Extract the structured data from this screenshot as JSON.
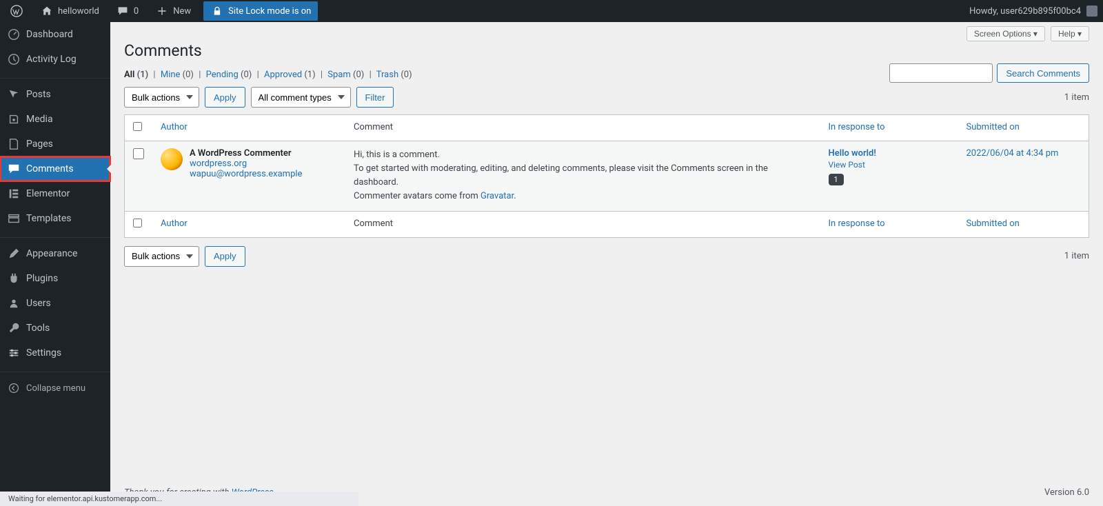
{
  "adminbar": {
    "site_name": "helloworld",
    "comment_count": "0",
    "new_label": "New",
    "site_lock_label": "Site Lock mode is on",
    "howdy_prefix": "Howdy, ",
    "user_name": "user629b895f00bc4"
  },
  "sidebar": {
    "items": [
      {
        "label": "Dashboard",
        "icon": "dashboard-icon"
      },
      {
        "label": "Activity Log",
        "icon": "activity-log-icon"
      },
      {
        "label": "Posts",
        "icon": "posts-icon"
      },
      {
        "label": "Media",
        "icon": "media-icon"
      },
      {
        "label": "Pages",
        "icon": "pages-icon"
      },
      {
        "label": "Comments",
        "icon": "comments-icon",
        "current": true
      },
      {
        "label": "Elementor",
        "icon": "elementor-icon"
      },
      {
        "label": "Templates",
        "icon": "templates-icon"
      },
      {
        "label": "Appearance",
        "icon": "appearance-icon"
      },
      {
        "label": "Plugins",
        "icon": "plugins-icon"
      },
      {
        "label": "Users",
        "icon": "users-icon"
      },
      {
        "label": "Tools",
        "icon": "tools-icon"
      },
      {
        "label": "Settings",
        "icon": "settings-icon"
      }
    ],
    "collapse_label": "Collapse menu"
  },
  "screen": {
    "options_label": "Screen Options ▾",
    "help_label": "Help ▾"
  },
  "page": {
    "title": "Comments"
  },
  "filters": {
    "all_label": "All",
    "all_count": "(1)",
    "mine_label": "Mine",
    "mine_count": "(0)",
    "pending_label": "Pending",
    "pending_count": "(0)",
    "approved_label": "Approved",
    "approved_count": "(1)",
    "spam_label": "Spam",
    "spam_count": "(0)",
    "trash_label": "Trash",
    "trash_count": "(0)"
  },
  "actions": {
    "bulk_label": "Bulk actions",
    "apply_label": "Apply",
    "type_label": "All comment types",
    "filter_label": "Filter"
  },
  "search": {
    "button": "Search Comments"
  },
  "pagination": {
    "item_count": "1 item"
  },
  "table": {
    "cols": {
      "author": "Author",
      "comment": "Comment",
      "response": "In response to",
      "date": "Submitted on"
    },
    "row": {
      "author_name": "A WordPress Commenter",
      "author_site": "wordpress.org",
      "author_email": "wapuu@wordpress.example",
      "body_line1": "Hi, this is a comment.",
      "body_line2": "To get started with moderating, editing, and deleting comments, please visit the Comments screen in the dashboard.",
      "body_line3_pre": "Commenter avatars come from ",
      "body_line3_link": "Gravatar",
      "body_line3_post": ".",
      "response_post": "Hello world!",
      "view_post": "View Post",
      "response_count": "1",
      "date": "2022/06/04 at 4:34 pm"
    }
  },
  "footer": {
    "thank_prefix": "Thank you for creating with ",
    "thank_link": "WordPress",
    "thank_suffix": ".",
    "version": "Version 6.0"
  },
  "statusbar": {
    "text": "Waiting for elementor.api.kustomerapp.com..."
  }
}
